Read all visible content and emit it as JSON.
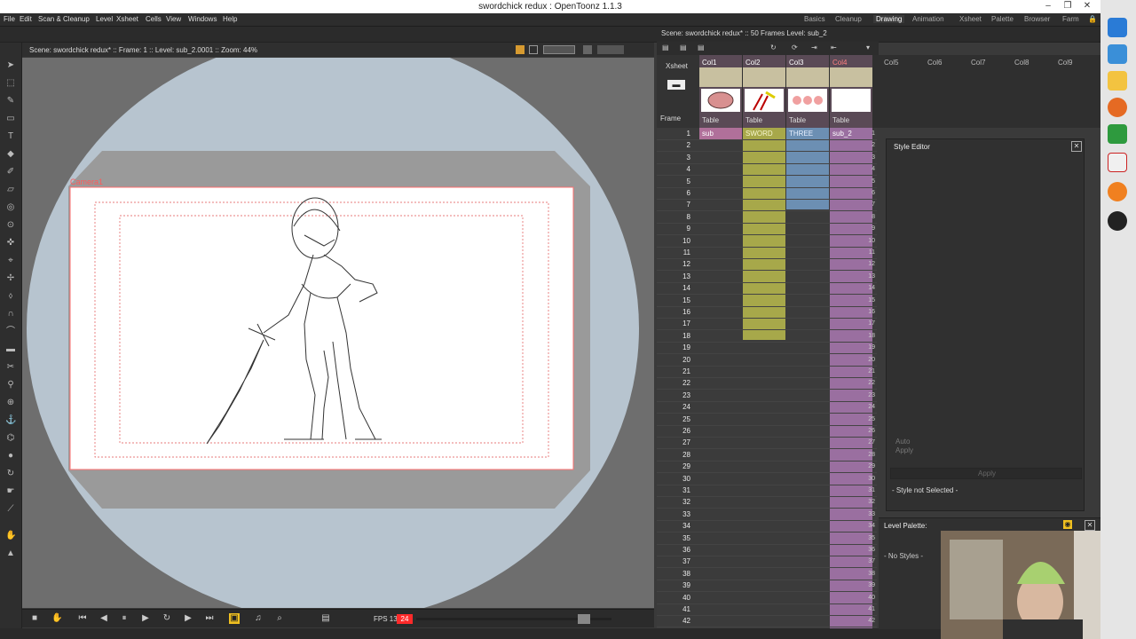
{
  "window": {
    "title": "swordchick redux : OpenToonz 1.1.3",
    "min": "–",
    "restore": "❐",
    "close": "✕"
  },
  "menu": [
    "File",
    "Edit",
    "Scan & Cleanup",
    "Level",
    "Xsheet",
    "Cells",
    "View",
    "Windows",
    "Help"
  ],
  "rooms": [
    "Basics",
    "Cleanup",
    "Drawing",
    "Animation",
    "Xsheet",
    "Palette",
    "Browser",
    "Farm"
  ],
  "active_room": "Drawing",
  "viewer": {
    "info": "Scene: swordchick redux* :: Frame: 1 :: Level: sub_2.0001 :: Zoom: 44%",
    "camera_label": "Camera1",
    "fps_label": "FPS 13/",
    "fps_value": "24"
  },
  "xsheet": {
    "info": "Scene: swordchick redux* :: 50 Frames Level: sub_2",
    "tab": "Xsheet",
    "frame_header": "Frame",
    "columns": [
      {
        "name": "Col1",
        "pegbar": "Table",
        "cell": "sub",
        "color": "#b0709a"
      },
      {
        "name": "Col2",
        "pegbar": "Table",
        "cell": "SWORD",
        "color": "#a7a84a"
      },
      {
        "name": "Col3",
        "pegbar": "Table",
        "cell": "THREE",
        "color": "#6c8fb3"
      },
      {
        "name": "Col4",
        "pegbar": "Table",
        "cell": "sub_2",
        "color": "#9a6fa0"
      },
      {
        "name": "Col5"
      },
      {
        "name": "Col6"
      },
      {
        "name": "Col7"
      },
      {
        "name": "Col8"
      },
      {
        "name": "Col9"
      }
    ],
    "frames": [
      1,
      2,
      3,
      4,
      5,
      6,
      7,
      8,
      9,
      10,
      11,
      12,
      13,
      14,
      15,
      16,
      17,
      18,
      19,
      20,
      21,
      22,
      23,
      24,
      25,
      26,
      27,
      28,
      29,
      30,
      31,
      32,
      33,
      34,
      35,
      36,
      37,
      38,
      39,
      40,
      41,
      42
    ],
    "sub_column_frames": [
      1,
      2,
      3,
      4,
      5,
      6,
      7,
      8,
      9,
      10,
      11,
      12,
      13,
      14,
      15,
      16,
      17,
      18,
      19,
      20,
      21,
      22,
      23,
      24,
      25,
      26,
      27,
      28,
      29,
      30,
      31,
      32,
      33,
      34,
      35,
      36,
      37,
      38,
      39,
      40,
      41,
      42
    ]
  },
  "style_editor": {
    "title": "Style Editor",
    "auto_label": "Auto",
    "apply_small": "Apply",
    "apply": "Apply",
    "status": "- Style not Selected -"
  },
  "level_palette": {
    "title": "Level Palette:",
    "empty": "- No Styles -"
  },
  "taskbar_icons": [
    "ie-icon",
    "store-icon",
    "folder-icon",
    "firefox-icon",
    "opentoonz-icon",
    "pen-app-icon",
    "blender-icon",
    "obs-icon"
  ]
}
